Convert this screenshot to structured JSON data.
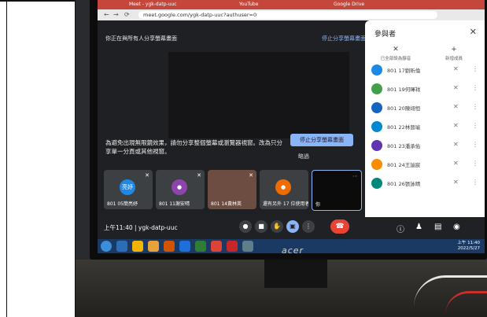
{
  "browser": {
    "tabs": [
      "Meet - ygk-datp-uuc",
      "YouTube",
      "Google Drive"
    ],
    "url": "meet.google.com/ygk-datp-uuc?authuser=0"
  },
  "meet": {
    "presenting_banner": "你正在與所有人分享螢幕畫面",
    "banner_stop": "停止分享螢幕畫面",
    "warning_text": "為避免出現無限鏡效果，請勿分享整個螢幕或瀏覽器視窗。改為只分享單一分頁或其他視窗。",
    "stop_button": "停止分享螢幕畫面",
    "dismiss": "略過",
    "tiles": [
      {
        "avatar": "亮妤",
        "name": "801 05簡亮妤",
        "color": "#1e88e5"
      },
      {
        "avatar": "",
        "name": "801 11謝安晴",
        "color": "#8e44ad"
      },
      {
        "avatar": "",
        "name": "801 14黃林英",
        "color": "#6d4c41"
      },
      {
        "avatar": "",
        "name": "還有另外 17 位使用者",
        "color": "#ef6c00"
      },
      {
        "avatar": "",
        "name": "你",
        "color": "#000000"
      }
    ],
    "meeting_time": "上午11:40",
    "meeting_code": "ygk-datp-uuc"
  },
  "panel": {
    "title": "參與者",
    "actions": [
      {
        "icon": "mute-all-icon",
        "label": "已全部設為靜音"
      },
      {
        "icon": "add-person-icon",
        "label": "新增成員"
      }
    ],
    "participants": [
      {
        "name": "801 17劉昕倫",
        "color": "#1e88e5"
      },
      {
        "name": "801 19何暉祥",
        "color": "#43a047"
      },
      {
        "name": "801 20陳翊恒",
        "color": "#1565c0"
      },
      {
        "name": "801 22林晉瑜",
        "color": "#0288d1"
      },
      {
        "name": "801 23潘承佑",
        "color": "#5e35b1"
      },
      {
        "name": "801 24王諭宸",
        "color": "#fb8c00"
      },
      {
        "name": "801 26張詠晴",
        "color": "#00897b"
      }
    ]
  },
  "taskbar": {
    "clock_time": "上午 11:40",
    "clock_date": "2022/5/27"
  },
  "monitor": {
    "brand": "acer"
  }
}
